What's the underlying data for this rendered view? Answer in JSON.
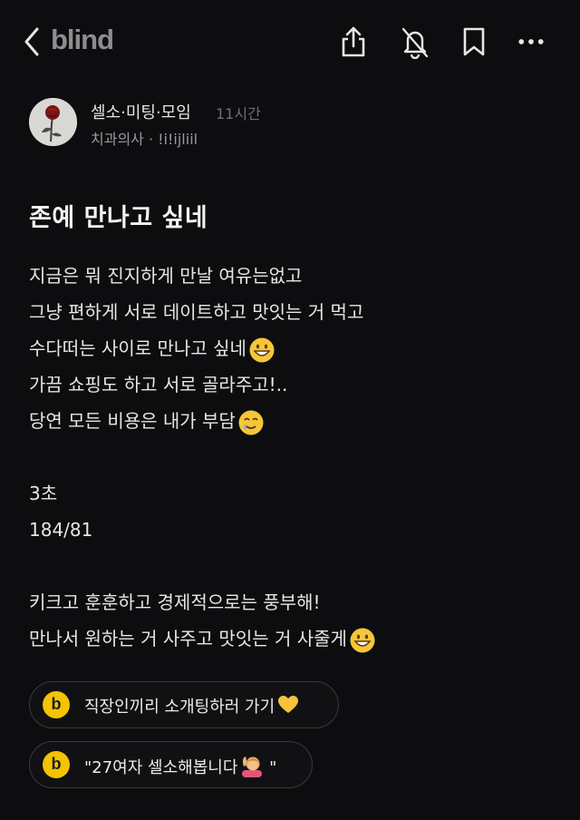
{
  "header": {
    "logo": "blind",
    "icons": [
      "back-icon",
      "share-icon",
      "notification-off-icon",
      "bookmark-icon",
      "more-icon"
    ]
  },
  "post": {
    "board": "셀소·미팅·모임",
    "time": "11시간",
    "author_meta": "치과의사 · !i!ijliil",
    "title": "존예 만나고 싶네",
    "body_lines": [
      "지금은 뭐 진지하게 만날 여유는없고",
      "그냥 편하게 서로 데이트하고 맛잇는 거 먹고",
      "수다떠는 사이로 만나고 싶네",
      "가끔 쇼핑도 하고 서로 골라주고!..",
      "당연 모든 비용은 내가 부담",
      "",
      "3초",
      "184/81",
      "",
      "키크고 훈훈하고 경제적으로는 풍부해!",
      "만나서 원하는 거 사주고 맛잇는 거 사줄게"
    ]
  },
  "chips": [
    {
      "badge": "b",
      "label": "직장인끼리 소개팅하러 가기"
    },
    {
      "badge": "b",
      "label": "\"27여자 셀소해봅니다"
    }
  ],
  "chip_suffix": [
    "",
    " \""
  ],
  "colors": {
    "background": "#0d0d0f",
    "badge": "#f4c400",
    "text": "#e9e9ea",
    "muted": "#6f6f73"
  }
}
